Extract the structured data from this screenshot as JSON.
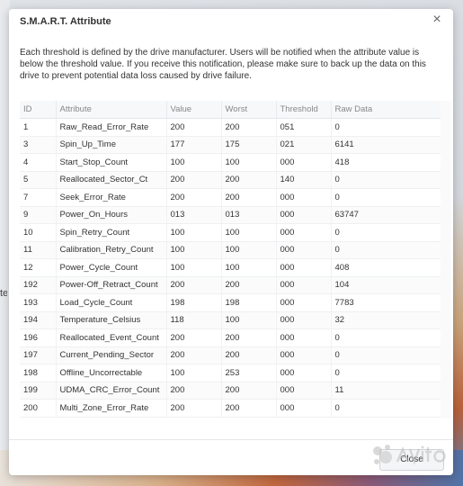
{
  "dialog": {
    "title": "S.M.A.R.T. Attribute",
    "description": "Each threshold is defined by the drive manufacturer. Users will be notified when the attribute value is below the threshold value. If you receive this notification, please make sure to back up the data on this drive to prevent potential data loss caused by drive failure.",
    "close_button_label": "Close"
  },
  "background": {
    "left_text": "te"
  },
  "table": {
    "columns": [
      "ID",
      "Attribute",
      "Value",
      "Worst",
      "Threshold",
      "Raw Data"
    ],
    "rows": [
      [
        "1",
        "Raw_Read_Error_Rate",
        "200",
        "200",
        "051",
        "0"
      ],
      [
        "3",
        "Spin_Up_Time",
        "177",
        "175",
        "021",
        "6141"
      ],
      [
        "4",
        "Start_Stop_Count",
        "100",
        "100",
        "000",
        "418"
      ],
      [
        "5",
        "Reallocated_Sector_Ct",
        "200",
        "200",
        "140",
        "0"
      ],
      [
        "7",
        "Seek_Error_Rate",
        "200",
        "200",
        "000",
        "0"
      ],
      [
        "9",
        "Power_On_Hours",
        "013",
        "013",
        "000",
        "63747"
      ],
      [
        "10",
        "Spin_Retry_Count",
        "100",
        "100",
        "000",
        "0"
      ],
      [
        "11",
        "Calibration_Retry_Count",
        "100",
        "100",
        "000",
        "0"
      ],
      [
        "12",
        "Power_Cycle_Count",
        "100",
        "100",
        "000",
        "408"
      ],
      [
        "192",
        "Power-Off_Retract_Count",
        "200",
        "200",
        "000",
        "104"
      ],
      [
        "193",
        "Load_Cycle_Count",
        "198",
        "198",
        "000",
        "7783"
      ],
      [
        "194",
        "Temperature_Celsius",
        "118",
        "100",
        "000",
        "32"
      ],
      [
        "196",
        "Reallocated_Event_Count",
        "200",
        "200",
        "000",
        "0"
      ],
      [
        "197",
        "Current_Pending_Sector",
        "200",
        "200",
        "000",
        "0"
      ],
      [
        "198",
        "Offline_Uncorrectable",
        "100",
        "253",
        "000",
        "0"
      ],
      [
        "199",
        "UDMA_CRC_Error_Count",
        "200",
        "200",
        "000",
        "11"
      ],
      [
        "200",
        "Multi_Zone_Error_Rate",
        "200",
        "200",
        "000",
        "0"
      ]
    ]
  },
  "icons": {
    "close": "close-icon",
    "watermark": "avito-logo"
  }
}
